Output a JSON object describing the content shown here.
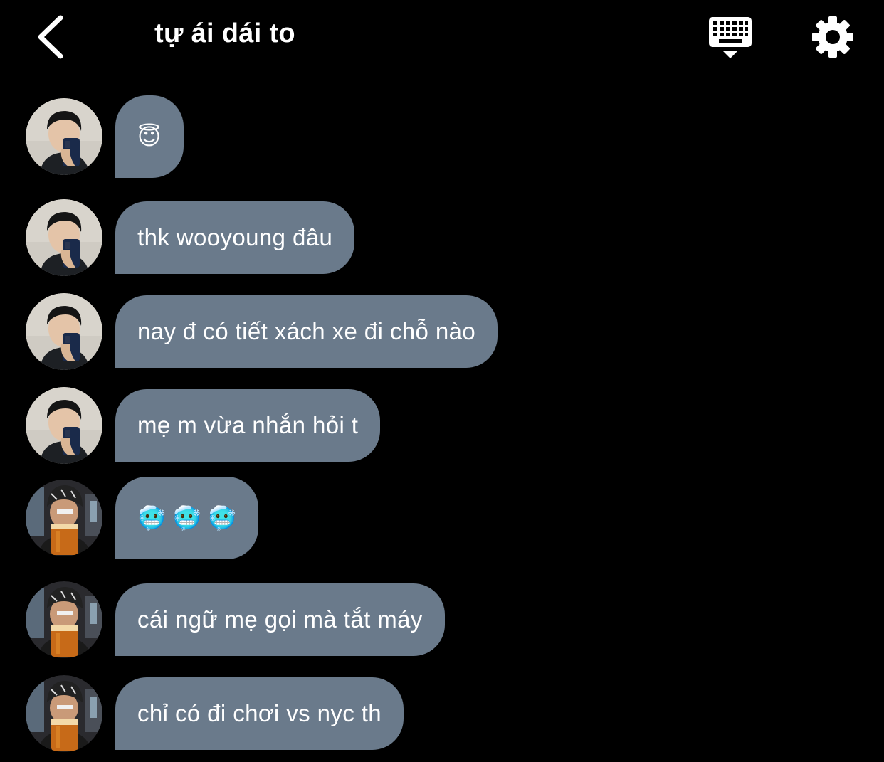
{
  "header": {
    "title": "tự ái dái to",
    "back_icon": "chevron-left-icon",
    "keyboard_icon": "keyboard-icon",
    "settings_icon": "gear-icon"
  },
  "colors": {
    "background": "#000000",
    "bubble": "#6a7a8b",
    "text": "#ffffff"
  },
  "messages": [
    {
      "sender": "user-a",
      "text": "😇",
      "kind": "emoji"
    },
    {
      "sender": "user-a",
      "text": "thk wooyoung đâu",
      "kind": "text"
    },
    {
      "sender": "user-a",
      "text": "nay đ có tiết xách xe đi chỗ nào",
      "kind": "text"
    },
    {
      "sender": "user-a",
      "text": "mẹ m vừa nhắn hỏi t",
      "kind": "text"
    },
    {
      "sender": "user-b",
      "text": "🥶 🥶 🥶",
      "kind": "emoji"
    },
    {
      "sender": "user-b",
      "text": "cái ngữ mẹ gọi mà tắt máy",
      "kind": "text"
    },
    {
      "sender": "user-b",
      "text": "chỉ có đi chơi vs nyc th",
      "kind": "text"
    }
  ]
}
